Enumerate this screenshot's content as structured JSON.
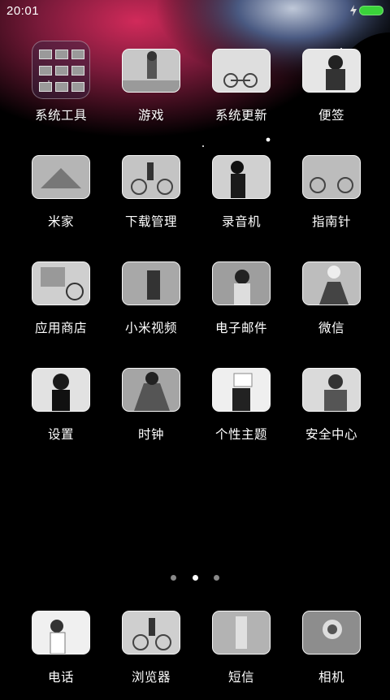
{
  "status_bar": {
    "time": "20:01"
  },
  "apps": [
    {
      "label": "系统工具",
      "kind": "folder"
    },
    {
      "label": "游戏"
    },
    {
      "label": "系统更新"
    },
    {
      "label": "便签"
    },
    {
      "label": "米家"
    },
    {
      "label": "下载管理"
    },
    {
      "label": "录音机"
    },
    {
      "label": "指南针"
    },
    {
      "label": "应用商店"
    },
    {
      "label": "小米视频"
    },
    {
      "label": "电子邮件"
    },
    {
      "label": "微信"
    },
    {
      "label": "设置"
    },
    {
      "label": "时钟"
    },
    {
      "label": "个性主题"
    },
    {
      "label": "安全中心"
    }
  ],
  "page_indicator": {
    "pages": 3,
    "current": 2
  },
  "dock": [
    {
      "label": "电话"
    },
    {
      "label": "浏览器"
    },
    {
      "label": "短信"
    },
    {
      "label": "相机"
    }
  ],
  "colors": {
    "battery": "#3ad33a",
    "sky_magenta": "#b0204a",
    "sky_blue": "#3a4a78"
  }
}
